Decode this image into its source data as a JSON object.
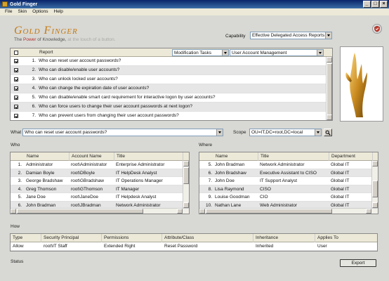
{
  "window": {
    "title": "Gold Finger",
    "buttons": [
      "_",
      "□",
      "×"
    ]
  },
  "menu": [
    "File",
    "Skin",
    "Options",
    "Help"
  ],
  "brand": {
    "logo": "Gold Finger",
    "tagline_pre": "The ",
    "tagline_power": "Power",
    "tagline_of": " of Knowledge,",
    "tagline_rest": " at the touch of a button."
  },
  "capability": {
    "label": "Capability",
    "value": "Effective Delegated Access Reports"
  },
  "report": {
    "header": "Report",
    "task_filter": "Modification Tasks",
    "category_filter": "User Account Management",
    "rows": [
      {
        "n": "1.",
        "text": "Who can reset user account passwords?"
      },
      {
        "n": "2.",
        "text": "Who can disable/enable user accounts?"
      },
      {
        "n": "3.",
        "text": "Who can unlock locked user accounts?"
      },
      {
        "n": "4.",
        "text": "Who can change the expiration date of user accounts?"
      },
      {
        "n": "5.",
        "text": "Who can disable/enable smart card requirement for interactive logon by user accounts?"
      },
      {
        "n": "6.",
        "text": "Who can force users to change their user account passwords at next logon?"
      },
      {
        "n": "7.",
        "text": "Who can prevent users from changing their user account passwords?"
      }
    ]
  },
  "what": {
    "label": "What",
    "value": "Who can reset user account passwords?"
  },
  "scope": {
    "label": "Scope",
    "value": "OU=IT,DC=root,DC=local"
  },
  "who": {
    "label": "Who",
    "columns": [
      "Name",
      "Account Name",
      "Title"
    ],
    "rows": [
      {
        "n": "1.",
        "name": "Administrator",
        "account": "root\\Administrator",
        "title": "Enterprise Administrator"
      },
      {
        "n": "2.",
        "name": "Damian Boyle",
        "account": "root\\DBoyle",
        "title": "IT HelpDesk Analyst"
      },
      {
        "n": "3.",
        "name": "George Bradshaw",
        "account": "root\\GBradshaw",
        "title": "IT Operations Manager"
      },
      {
        "n": "4.",
        "name": "Greg Thomson",
        "account": "root\\GThomson",
        "title": "IT Manager"
      },
      {
        "n": "5.",
        "name": "Jane Doe",
        "account": "root\\JaneDoe",
        "title": "IT Helpdesk Analyst"
      },
      {
        "n": "6.",
        "name": "John Bradman",
        "account": "root\\JBradman",
        "title": "Network Administrator"
      }
    ]
  },
  "where": {
    "label": "Where",
    "columns": [
      "Name",
      "Title",
      "Department"
    ],
    "rows": [
      {
        "n": "5.",
        "name": "John Bradman",
        "title": "Network Administrator",
        "dept": "Global IT"
      },
      {
        "n": "6.",
        "name": "John Bradshaw",
        "title": "Executive Assistant to CISO",
        "dept": "Global IT"
      },
      {
        "n": "7.",
        "name": "John Doe",
        "title": "IT Support Analyst",
        "dept": "Global IT"
      },
      {
        "n": "8.",
        "name": "Lisa Raymond",
        "title": "CISO",
        "dept": "Global IT"
      },
      {
        "n": "9.",
        "name": "Louise Goodman",
        "title": "CIO",
        "dept": "Global IT"
      },
      {
        "n": "10.",
        "name": "Nathan Lane",
        "title": "Web Administrator",
        "dept": "Global IT"
      }
    ]
  },
  "how": {
    "label": "How",
    "columns": [
      "Type",
      "Security Principal",
      "Permissions",
      "Attribute/Class",
      "Inheritance",
      "Applies To"
    ],
    "rows": [
      {
        "type": "Allow",
        "principal": "root\\IT Staff",
        "permissions": "Extended Right",
        "attribute": "Reset Password",
        "inheritance": "Inherited",
        "applies": "User"
      }
    ]
  },
  "status": {
    "label": "Status"
  },
  "export_label": "Export"
}
